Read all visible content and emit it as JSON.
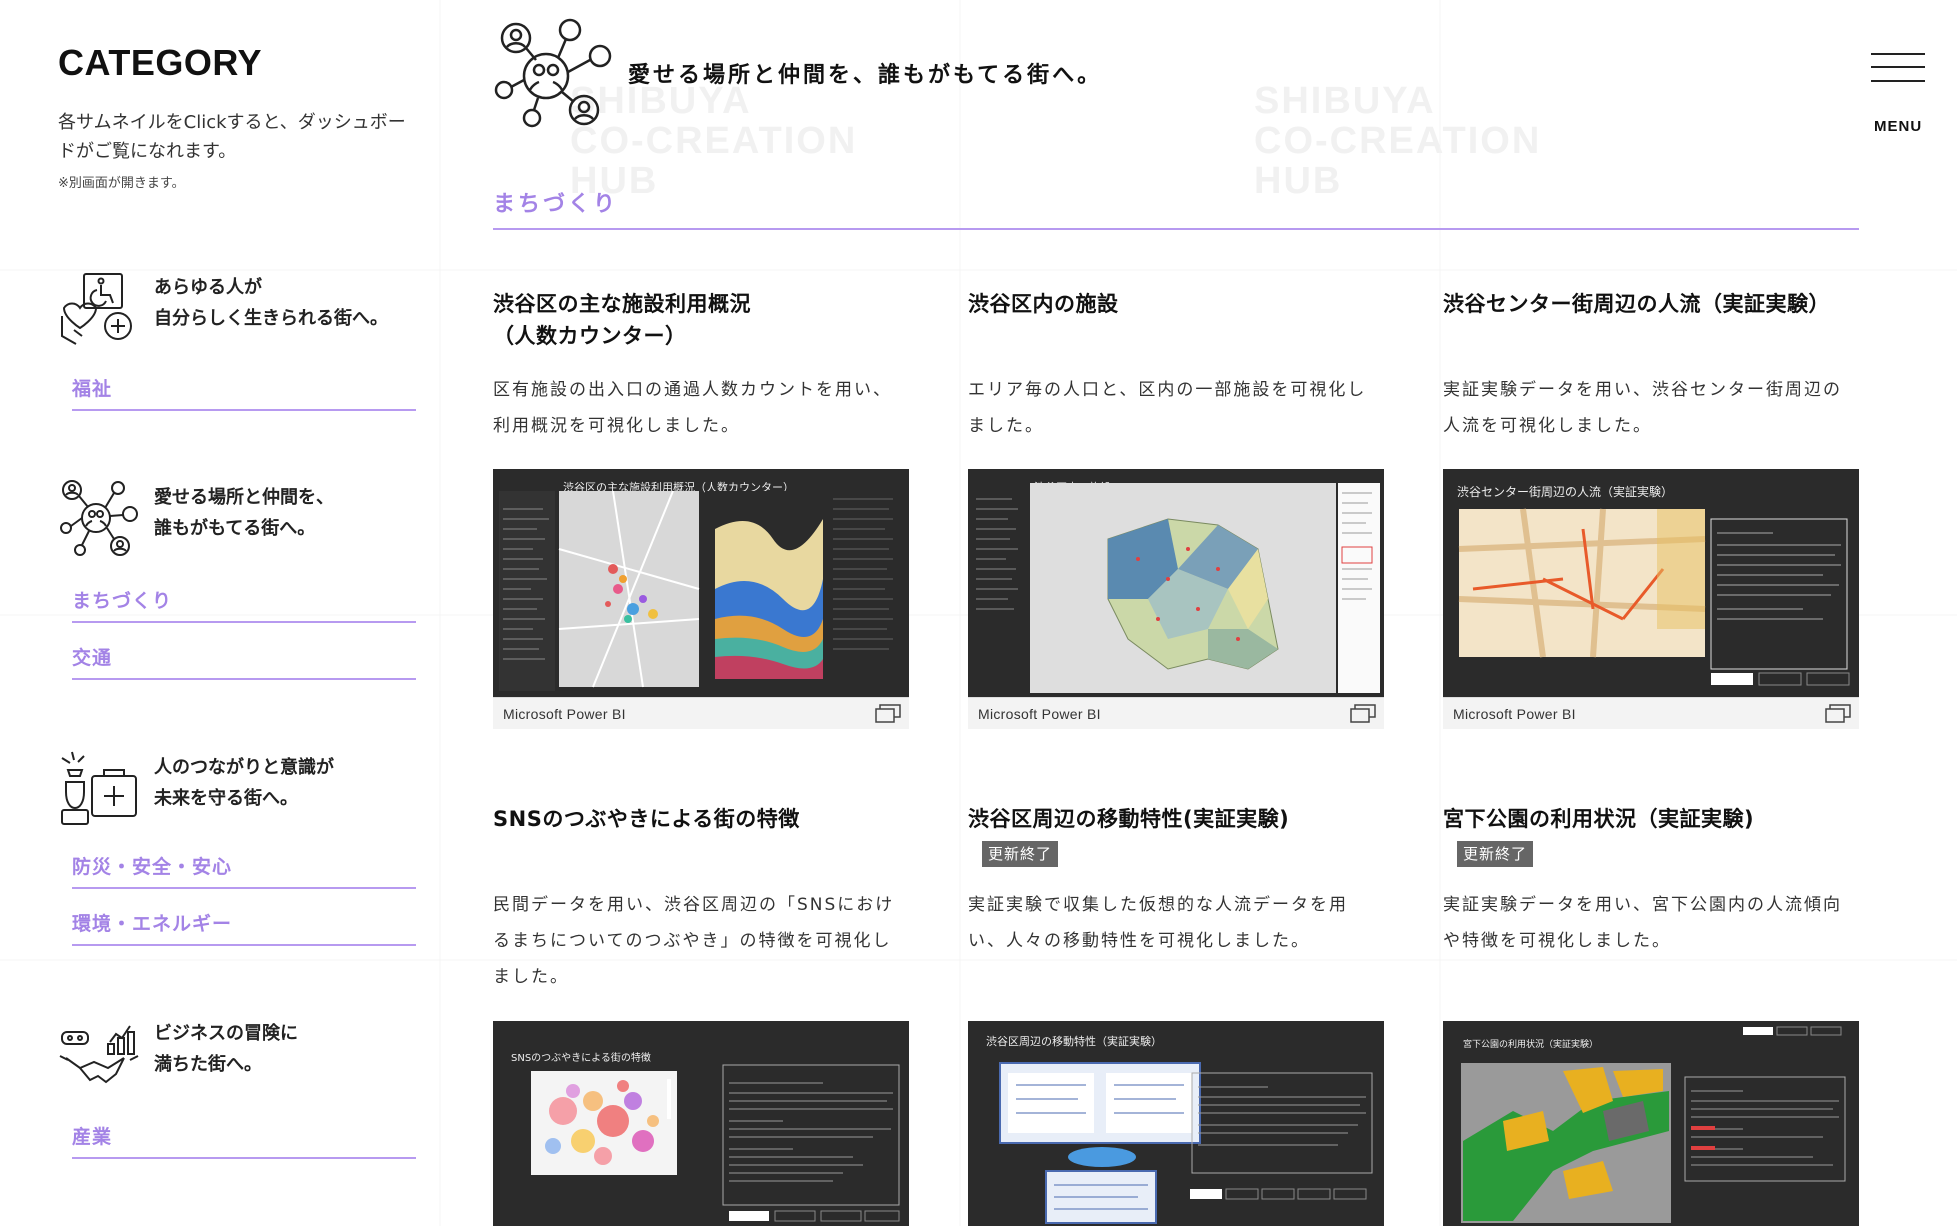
{
  "sidebar": {
    "title": "CATEGORY",
    "description": "各サムネイルをClickすると、ダッシュボードがご覧になれます。",
    "note": "※別画面が開きます。",
    "groups": [
      {
        "icon": "accessibility-heart-icon",
        "line1": "あらゆる人が",
        "line2": "自分らしく生きられる街へ。",
        "links": [
          "福祉"
        ]
      },
      {
        "icon": "people-network-icon",
        "line1": "愛せる場所と仲間を、",
        "line2": "誰もがもてる街へ。",
        "links": [
          "まちづくり",
          "交通"
        ]
      },
      {
        "icon": "emergency-kit-icon",
        "line1": "人のつながりと意識が",
        "line2": "未来を守る街へ。",
        "links": [
          "防災・安全・安心",
          "環境・エネルギー"
        ]
      },
      {
        "icon": "business-handshake-icon",
        "line1": "ビジネスの冒険に",
        "line2": "満ちた街へ。",
        "links": [
          "産業"
        ]
      }
    ]
  },
  "header": {
    "tagline": "愛せる場所と仲間を、誰もがもてる街へ。",
    "menu_label": "MENU"
  },
  "section": {
    "title": "まちづくり"
  },
  "cards": [
    {
      "title": "渋谷区の主な施設利用概況（人数カウンター）",
      "badge": "",
      "desc": "区有施設の出入口の通過人数カウントを用い、利用概況を可視化しました。",
      "thumb_title": "渋谷区の主な施設利用概況（人数カウンター）",
      "footer": "Microsoft Power BI"
    },
    {
      "title": "渋谷区内の施設",
      "badge": "",
      "desc": "エリア毎の人口と、区内の一部施設を可視化しました。",
      "thumb_title": "渋谷区内の施設",
      "footer": "Microsoft Power BI"
    },
    {
      "title": "渋谷センター街周辺の人流（実証実験）",
      "badge": "",
      "desc": "実証実験データを用い、渋谷センター街周辺の人流を可視化しました。",
      "thumb_title": "渋谷センター街周辺の人流（実証実験）",
      "footer": "Microsoft Power BI"
    },
    {
      "title": "SNSのつぶやきによる街の特徴",
      "badge": "",
      "desc": "民間データを用い、渋谷区周辺の「SNSにおけるまちについてのつぶやき」の特徴を可視化しました。",
      "thumb_title": "SNSのつぶやきによる街の特徴",
      "footer": ""
    },
    {
      "title": "渋谷区周辺の移動特性(実証実験)",
      "badge": "更新終了",
      "desc": "実証実験で収集した仮想的な人流データを用い、人々の移動特性を可視化しました。",
      "thumb_title": "渋谷区周辺の移動特性（実証実験）",
      "footer": ""
    },
    {
      "title": "宮下公園の利用状況（実証実験)",
      "badge": "更新終了",
      "desc": "実証実験データを用い、宮下公園内の人流傾向や特徴を可視化しました。",
      "thumb_title": "宮下公園の利用状況（実証実験）",
      "footer": ""
    }
  ],
  "colors": {
    "accent": "#a383e6",
    "accent_line": "#b79af0",
    "thumb_bg": "#2b2b2b"
  },
  "watermark": [
    "SHIBUYA",
    "CO-CREATION",
    "HUB"
  ]
}
